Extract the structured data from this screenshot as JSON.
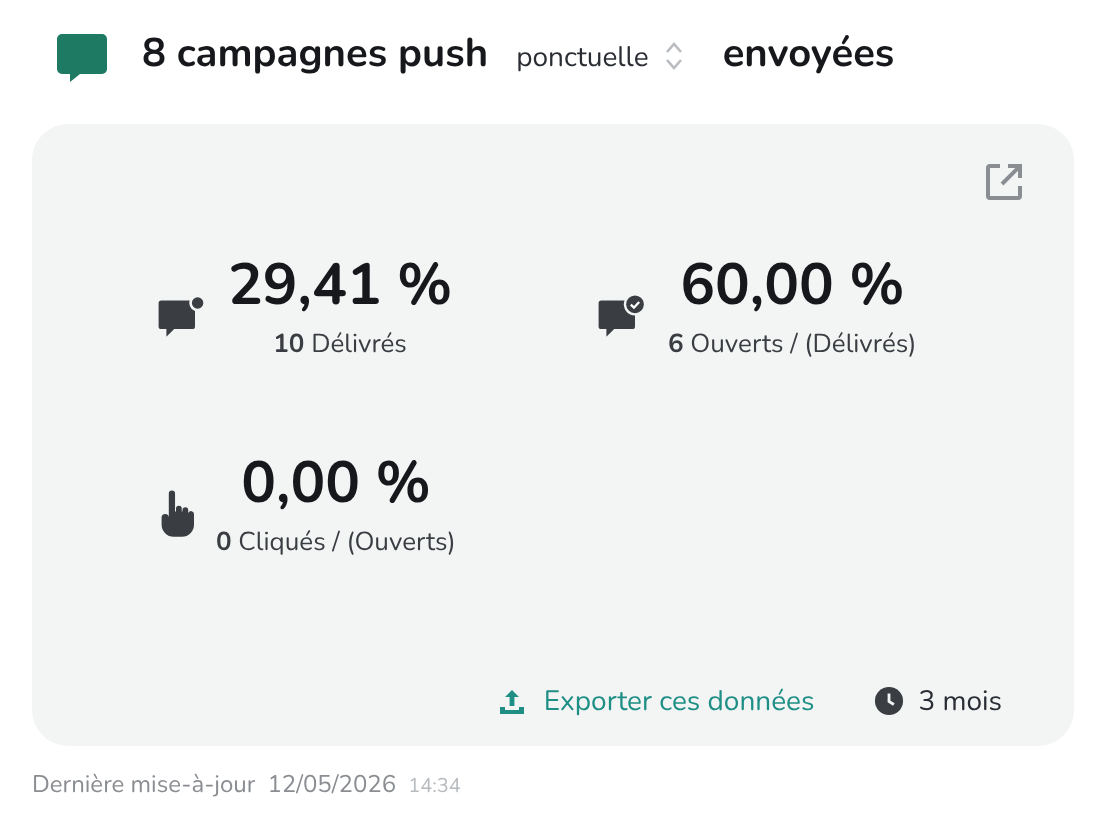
{
  "header": {
    "title": "8 campagnes push",
    "selector": "ponctuelle",
    "suffix": "envoyées"
  },
  "stats": [
    {
      "kind": "delivered",
      "value": "29,41 %",
      "caption": "**10** Délivrés"
    },
    {
      "kind": "opened",
      "value": "60,00 %",
      "caption": "**6** Ouverts / (Délivrés)"
    },
    {
      "kind": "clicked",
      "value": "0,00 %",
      "caption": "**0** Cliqués / (Ouverts)"
    }
  ],
  "export_link": "Exporter ces données",
  "period": "3 mois",
  "last_update": {
    "label": "Dernière mise-à-jour",
    "date": "12/05/2026",
    "time": "14:34"
  }
}
